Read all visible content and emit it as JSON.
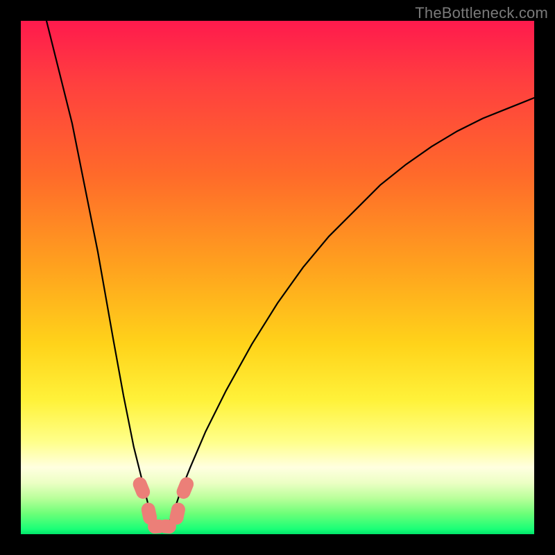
{
  "watermark": "TheBottleneck.com",
  "chart_data": {
    "type": "line",
    "title": "",
    "xlabel": "",
    "ylabel": "",
    "xlim": [
      0,
      100
    ],
    "ylim": [
      0,
      100
    ],
    "grid": false,
    "curve": {
      "description": "V-shaped bottleneck curve; y is mismatch %, minimum near x≈27",
      "x": [
        5,
        10,
        15,
        18,
        20,
        22,
        24,
        25,
        26,
        27,
        28,
        29,
        30,
        31,
        33,
        36,
        40,
        45,
        50,
        55,
        60,
        65,
        70,
        75,
        80,
        85,
        90,
        95,
        100
      ],
      "y": [
        100,
        80,
        55,
        38,
        27,
        17,
        9,
        5,
        2,
        0.5,
        1,
        2.5,
        5,
        8,
        13,
        20,
        28,
        37,
        45,
        52,
        58,
        63,
        68,
        72,
        75.5,
        78.5,
        81,
        83,
        85
      ]
    },
    "markers": {
      "description": "salmon rounded markers near the curve minimum",
      "points": [
        {
          "x": 23.5,
          "y": 9
        },
        {
          "x": 25.0,
          "y": 4
        },
        {
          "x": 26.5,
          "y": 1.5
        },
        {
          "x": 28.5,
          "y": 1.5
        },
        {
          "x": 30.5,
          "y": 4
        },
        {
          "x": 32.0,
          "y": 9
        }
      ],
      "color": "#ec7f78"
    },
    "gradient_stops": [
      {
        "pct": 0,
        "color": "#ff1a4d"
      },
      {
        "pct": 30,
        "color": "#ff6a2a"
      },
      {
        "pct": 63,
        "color": "#ffd31a"
      },
      {
        "pct": 87,
        "color": "#ffffe0"
      },
      {
        "pct": 100,
        "color": "#00e46a"
      }
    ]
  }
}
